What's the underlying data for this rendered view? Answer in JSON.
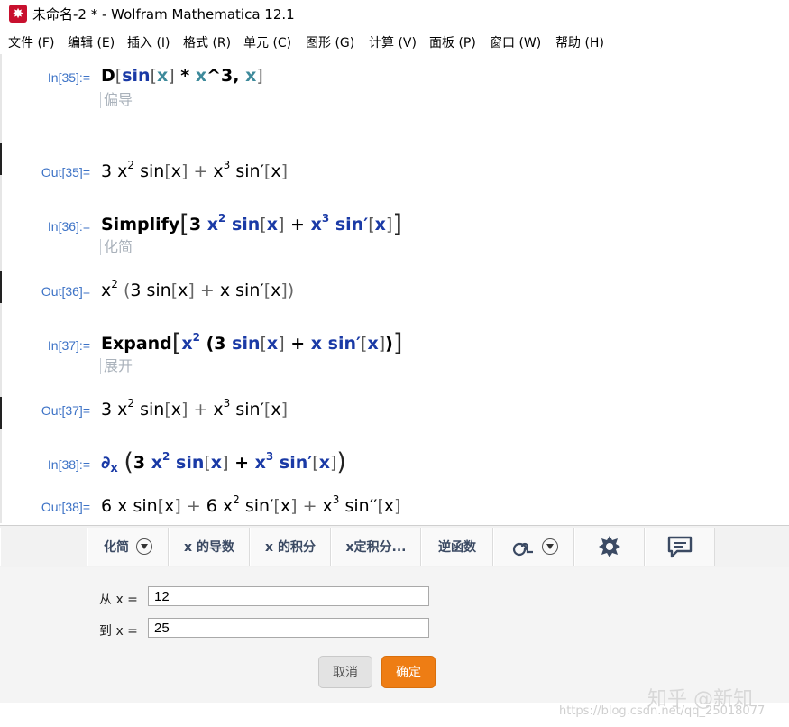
{
  "window": {
    "title": "未命名-2 * - Wolfram Mathematica 12.1"
  },
  "menu": [
    "文件 (F)",
    "编辑 (E)",
    "插入 (I)",
    "格式 (R)",
    "单元 (C)",
    "图形 (G)",
    "计算 (V)",
    "面板 (P)",
    "窗口 (W)",
    "帮助 (H)"
  ],
  "cells": {
    "in35": {
      "label": "In[35]:=",
      "hint": "偏导"
    },
    "out35": {
      "label": "Out[35]="
    },
    "in36": {
      "label": "In[36]:=",
      "hint": "化简"
    },
    "out36": {
      "label": "Out[36]="
    },
    "in37": {
      "label": "In[37]:=",
      "hint": "展开"
    },
    "out37": {
      "label": "Out[37]="
    },
    "in38": {
      "label": "In[38]:="
    },
    "out38": {
      "label": "Out[38]="
    }
  },
  "expr": {
    "D": "D",
    "sin": "sin",
    "x": "x",
    "times": "*",
    "pow": "^3",
    "comma": ",",
    "Simplify": "Simplify",
    "Expand": "Expand",
    "partial": "∂",
    "n2": "2",
    "n3": "3",
    "n6": "6",
    "prime": "′",
    "dprime": "′′",
    "plus": "+",
    "lb": "[",
    "rb": "]",
    "lp": "(",
    "rp": ")"
  },
  "toolbar": {
    "simplify": "化简",
    "derivative": "x 的导数",
    "integral": "x 的积分",
    "definite_integral": "x定积分...",
    "inverse": "逆函数"
  },
  "panel": {
    "from_label": "从 x =",
    "from_value": "12",
    "to_label": "到 x =",
    "to_value": "25",
    "cancel": "取消",
    "ok": "确定"
  },
  "watermark": {
    "zhihu": "知乎 @新知",
    "url": "https://blog.csdn.net/qq_25018077"
  }
}
